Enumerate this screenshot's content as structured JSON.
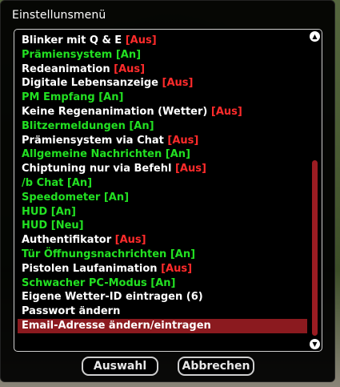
{
  "dialog": {
    "title": "Einstellunsmenü"
  },
  "colors": {
    "on": "#22e022",
    "off": "#ff2b2b",
    "neutral": "#ffffff",
    "selected_bg": "#8b1a1f"
  },
  "scrollbar": {
    "up_icon": "▲",
    "down_icon": "▼",
    "scroll_position_fraction": 0.45,
    "visible_fraction": 0.6
  },
  "items": [
    {
      "label": "Blinker mit Q & E",
      "status": "[Aus]",
      "label_color": "#ffffff",
      "status_color": "#ff2b2b"
    },
    {
      "label": "Prämiensystem [An]",
      "status": "",
      "label_color": "#22e022",
      "status_color": ""
    },
    {
      "label": "Redeanimation",
      "status": "[Aus]",
      "label_color": "#ffffff",
      "status_color": "#ff2b2b"
    },
    {
      "label": "Digitale Lebensanzeige",
      "status": "[Aus]",
      "label_color": "#ffffff",
      "status_color": "#ff2b2b"
    },
    {
      "label": "PM Empfang [An]",
      "status": "",
      "label_color": "#22e022",
      "status_color": ""
    },
    {
      "label": "Keine Regenanimation (Wetter)",
      "status": "[Aus]",
      "label_color": "#ffffff",
      "status_color": "#ff2b2b"
    },
    {
      "label": "Blitzermeldungen [An]",
      "status": "",
      "label_color": "#22e022",
      "status_color": ""
    },
    {
      "label": "Prämiensystem via Chat",
      "status": "[Aus]",
      "label_color": "#ffffff",
      "status_color": "#ff2b2b"
    },
    {
      "label": "Allgemeine Nachrichten [An]",
      "status": "",
      "label_color": "#22e022",
      "status_color": ""
    },
    {
      "label": "Chiptuning nur via Befehl",
      "status": "[Aus]",
      "label_color": "#ffffff",
      "status_color": "#ff2b2b"
    },
    {
      "label": "/b Chat [An]",
      "status": "",
      "label_color": "#22e022",
      "status_color": ""
    },
    {
      "label": "Speedometer [An]",
      "status": "",
      "label_color": "#22e022",
      "status_color": ""
    },
    {
      "label": "HUD [An]",
      "status": "",
      "label_color": "#22e022",
      "status_color": ""
    },
    {
      "label": "HUD [Neu]",
      "status": "",
      "label_color": "#22e022",
      "status_color": ""
    },
    {
      "label": "Authentifikator",
      "status": "[Aus]",
      "label_color": "#ffffff",
      "status_color": "#ff2b2b"
    },
    {
      "label": "Tür Öffnungsnachrichten [An]",
      "status": "",
      "label_color": "#22e022",
      "status_color": ""
    },
    {
      "label": "Pistolen Laufanimation",
      "status": "[Aus]",
      "label_color": "#ffffff",
      "status_color": "#ff2b2b"
    },
    {
      "label": "Schwacher PC-Modus [An]",
      "status": "",
      "label_color": "#22e022",
      "status_color": ""
    },
    {
      "label": "Eigene Wetter-ID eintragen (6)",
      "status": "",
      "label_color": "#ffffff",
      "status_color": ""
    },
    {
      "label": "Passwort ändern",
      "status": "",
      "label_color": "#ffffff",
      "status_color": ""
    },
    {
      "label": "Email-Adresse ändern/eintragen",
      "status": "",
      "label_color": "#ffffff",
      "status_color": "",
      "selected": true
    }
  ],
  "buttons": {
    "select_label": "Auswahl",
    "cancel_label": "Abbrechen"
  }
}
